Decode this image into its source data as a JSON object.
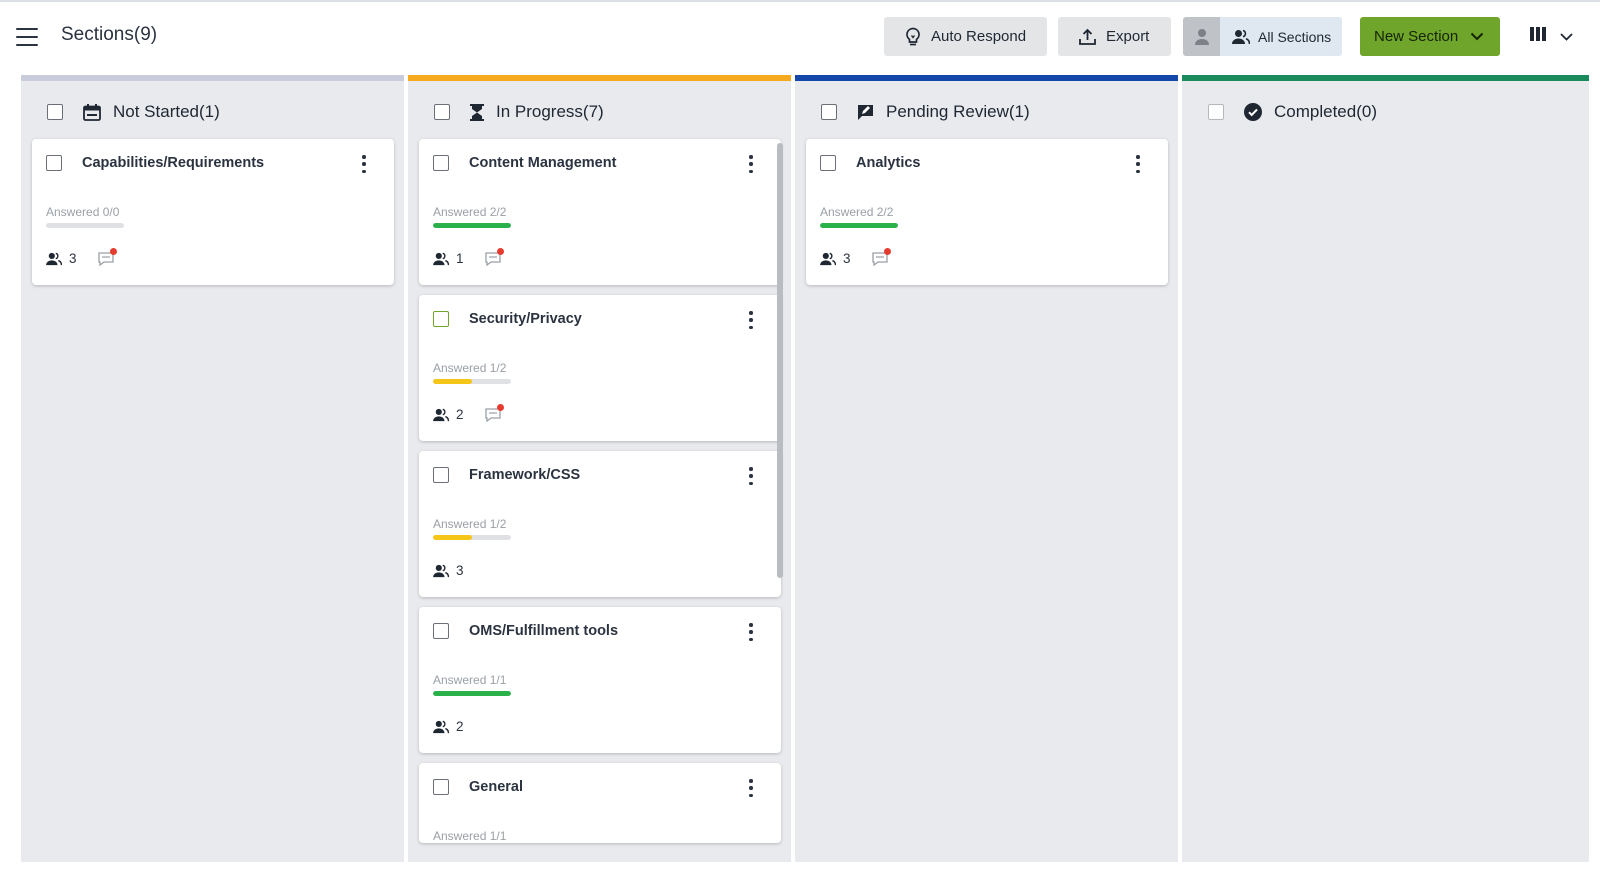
{
  "header": {
    "title": "Sections(9)",
    "auto_respond_label": "Auto Respond",
    "export_label": "Export",
    "all_sections_label": "All Sections",
    "new_section_label": "New Section"
  },
  "colors": {
    "not_started": "#c9ccdc",
    "in_progress": "#f5a91f",
    "pending_review": "#1547a8",
    "completed": "#1a8a5c",
    "progress_green": "#2bb14a",
    "progress_yellow": "#f5c518",
    "primary_button": "#6fa52a"
  },
  "columns": [
    {
      "title": "Not Started(1)",
      "icon": "calendar-icon",
      "cards": [
        {
          "title": "Capabilities/Requirements",
          "answered": "Answered 0/0",
          "progress": 0,
          "assignees": "3",
          "has_comment": true
        }
      ]
    },
    {
      "title": "In Progress(7)",
      "icon": "hourglass-icon",
      "cards": [
        {
          "title": "Content Management",
          "answered": "Answered 2/2",
          "progress": 1.0,
          "assignees": "1",
          "has_comment": true
        },
        {
          "title": "Security/Privacy",
          "answered": "Answered 1/2",
          "progress": 0.5,
          "assignees": "2",
          "has_comment": true
        },
        {
          "title": "Framework/CSS",
          "answered": "Answered 1/2",
          "progress": 0.5,
          "assignees": "3",
          "has_comment": false
        },
        {
          "title": "OMS/Fulfillment tools",
          "answered": "Answered 1/1",
          "progress": 1.0,
          "assignees": "2",
          "has_comment": false
        },
        {
          "title": "General",
          "answered": "Answered 1/1",
          "progress": 1.0,
          "assignees": "",
          "has_comment": false
        }
      ]
    },
    {
      "title": "Pending Review(1)",
      "icon": "review-icon",
      "cards": [
        {
          "title": "Analytics",
          "answered": "Answered 2/2",
          "progress": 1.0,
          "assignees": "3",
          "has_comment": true
        }
      ]
    },
    {
      "title": "Completed(0)",
      "icon": "check-circle-icon",
      "cards": []
    }
  ]
}
